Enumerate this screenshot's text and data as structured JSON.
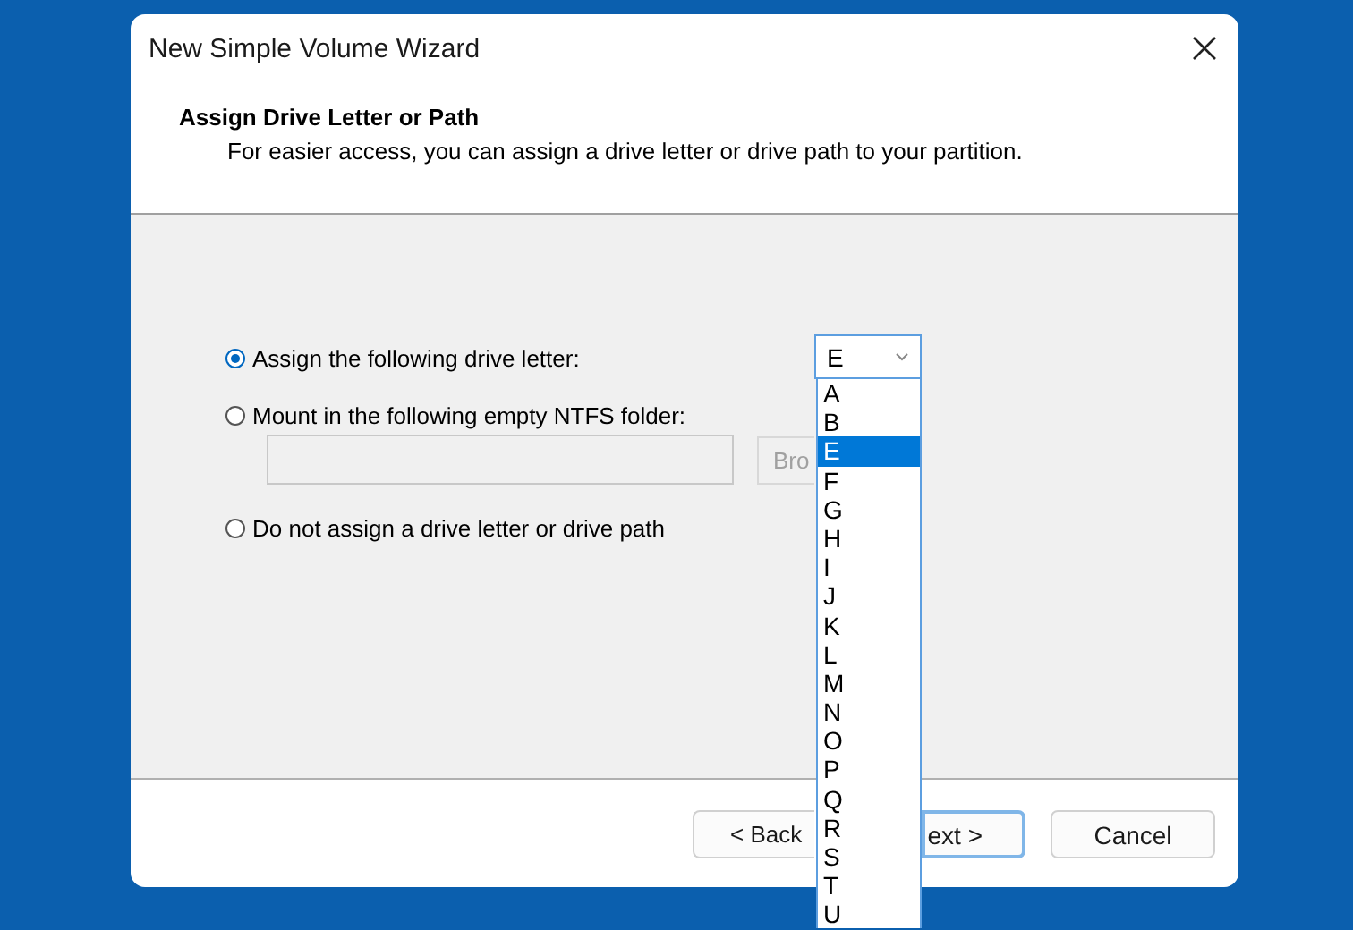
{
  "window": {
    "title": "New Simple Volume Wizard"
  },
  "header": {
    "title": "Assign Drive Letter or Path",
    "subtitle": "For easier access, you can assign a drive letter or drive path to your partition."
  },
  "options": [
    {
      "label": "Assign the following drive letter:",
      "selected": true
    },
    {
      "label": "Mount in the following empty NTFS folder:",
      "selected": false
    },
    {
      "label": "Do not assign a drive letter or drive path",
      "selected": false
    }
  ],
  "drive_letter": {
    "value": "E",
    "expanded": true,
    "items": [
      {
        "label": "A",
        "selected": false
      },
      {
        "label": "B",
        "selected": false
      },
      {
        "label": "E",
        "selected": true
      },
      {
        "label": "F",
        "selected": false
      },
      {
        "label": "G",
        "selected": false
      },
      {
        "label": "H",
        "selected": false
      },
      {
        "label": "I",
        "selected": false
      },
      {
        "label": "J",
        "selected": false
      },
      {
        "label": "K",
        "selected": false
      },
      {
        "label": "L",
        "selected": false
      },
      {
        "label": "M",
        "selected": false
      },
      {
        "label": "N",
        "selected": false
      },
      {
        "label": "O",
        "selected": false
      },
      {
        "label": "P",
        "selected": false
      },
      {
        "label": "Q",
        "selected": false
      },
      {
        "label": "R",
        "selected": false
      },
      {
        "label": "S",
        "selected": false
      },
      {
        "label": "T",
        "selected": false
      },
      {
        "label": "U",
        "selected": false
      }
    ]
  },
  "folder_field": {
    "disabled": true
  },
  "browse_button": {
    "label": "Bro",
    "disabled": true
  },
  "buttons": [
    {
      "label": "< Back",
      "default": false
    },
    {
      "label": "ext >",
      "default": true
    },
    {
      "label": "Cancel",
      "default": false
    }
  ]
}
